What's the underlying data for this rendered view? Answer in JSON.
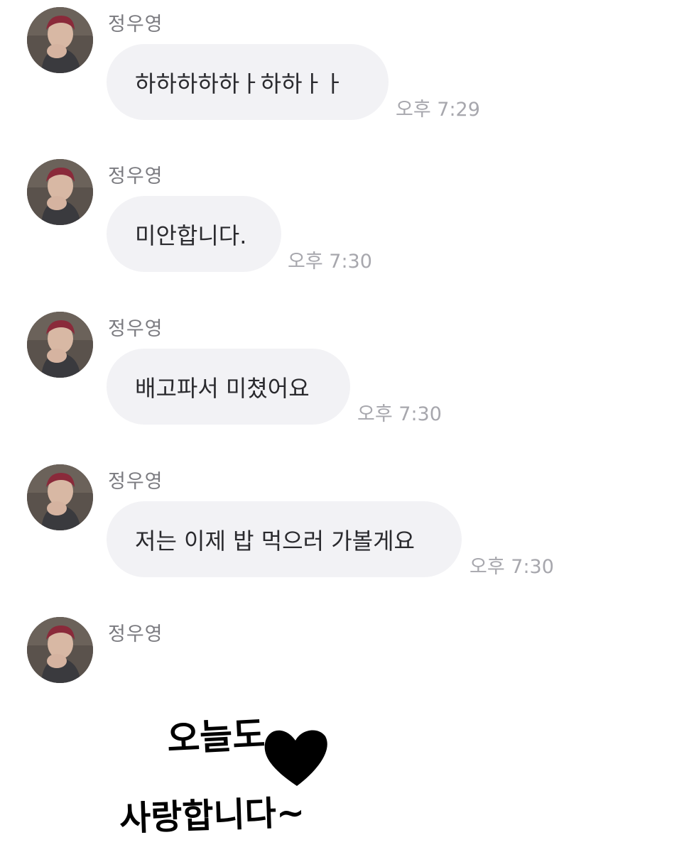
{
  "messages": [
    {
      "sender": "정우영",
      "text": "하하하하하ㅏ하하ㅏㅏ",
      "time": "오후 7:29"
    },
    {
      "sender": "정우영",
      "text": "미안합니다.",
      "time": "오후 7:30"
    },
    {
      "sender": "정우영",
      "text": "배고파서 미쳤어요",
      "time": "오후 7:30"
    },
    {
      "sender": "정우영",
      "text": "저는 이제 밥 먹으러 가볼게요",
      "time": "오후 7:30"
    }
  ],
  "sticker_message": {
    "sender": "정우영",
    "sticker_text_line1": "오늘도",
    "sticker_text_line2": "사랑합니다~",
    "sticker_icon": "heart-icon"
  },
  "colors": {
    "bubble_bg": "#f2f2f5",
    "sender_name": "#7b7b80",
    "timestamp": "#a7a7ad",
    "message_text": "#2a2a2e"
  }
}
